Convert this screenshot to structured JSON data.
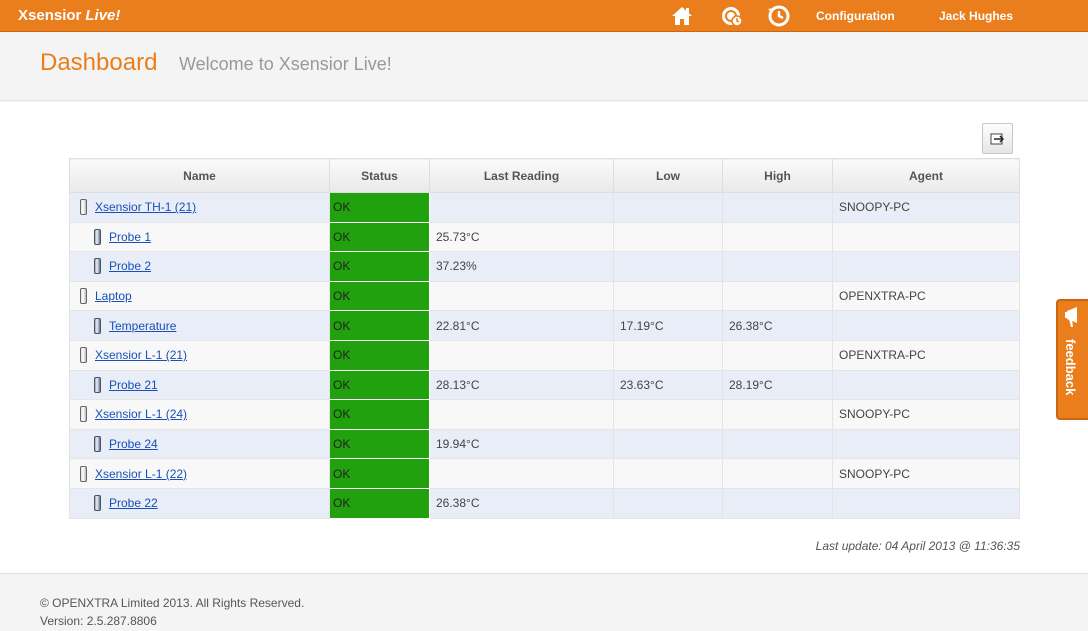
{
  "topbar": {
    "brand": "Xsensior",
    "brand_live": "Live!",
    "icons": [
      "home-icon",
      "sensor-clock-icon",
      "history-icon"
    ],
    "configuration_label": "Configuration",
    "user_name": "Jack Hughes"
  },
  "header": {
    "title": "Dashboard",
    "subtitle": "Welcome to Xsensior Live!"
  },
  "table": {
    "columns": [
      "Name",
      "Status",
      "Last Reading",
      "Low",
      "High",
      "Agent"
    ],
    "rows": [
      {
        "level": "device",
        "name": "Xsensior TH-1 (21)",
        "status": "OK",
        "last": "",
        "low": "",
        "high": "",
        "agent": "SNOOPY-PC"
      },
      {
        "level": "probe",
        "name": "Probe 1",
        "status": "OK",
        "last": "25.73°C",
        "low": "",
        "high": "",
        "agent": ""
      },
      {
        "level": "probe",
        "name": "Probe 2",
        "status": "OK",
        "last": "37.23%",
        "low": "",
        "high": "",
        "agent": ""
      },
      {
        "level": "device",
        "name": "Laptop",
        "status": "OK",
        "last": "",
        "low": "",
        "high": "",
        "agent": "OPENXTRA-PC"
      },
      {
        "level": "probe",
        "name": "Temperature",
        "status": "OK",
        "last": "22.81°C",
        "low": "17.19°C",
        "high": "26.38°C",
        "agent": ""
      },
      {
        "level": "device",
        "name": "Xsensior L-1 (21)",
        "status": "OK",
        "last": "",
        "low": "",
        "high": "",
        "agent": "OPENXTRA-PC"
      },
      {
        "level": "probe",
        "name": "Probe 21",
        "status": "OK",
        "last": "28.13°C",
        "low": "23.63°C",
        "high": "28.19°C",
        "agent": ""
      },
      {
        "level": "device",
        "name": "Xsensior L-1 (24)",
        "status": "OK",
        "last": "",
        "low": "",
        "high": "",
        "agent": "SNOOPY-PC"
      },
      {
        "level": "probe",
        "name": "Probe 24",
        "status": "OK",
        "last": "19.94°C",
        "low": "",
        "high": "",
        "agent": ""
      },
      {
        "level": "device",
        "name": "Xsensior L-1 (22)",
        "status": "OK",
        "last": "",
        "low": "",
        "high": "",
        "agent": "SNOOPY-PC"
      },
      {
        "level": "probe",
        "name": "Probe 22",
        "status": "OK",
        "last": "26.38°C",
        "low": "",
        "high": "",
        "agent": ""
      }
    ]
  },
  "last_update": "Last update: 04 April 2013 @ 11:36:35",
  "footer": {
    "copyright": "© OPENXTRA Limited 2013. All Rights Reserved.",
    "version": "Version: 2.5.287.8806"
  },
  "feedback_label": "feedback",
  "colors": {
    "accent": "#ea7e1c",
    "status_ok": "#22a10e",
    "link": "#1a4fb8"
  }
}
